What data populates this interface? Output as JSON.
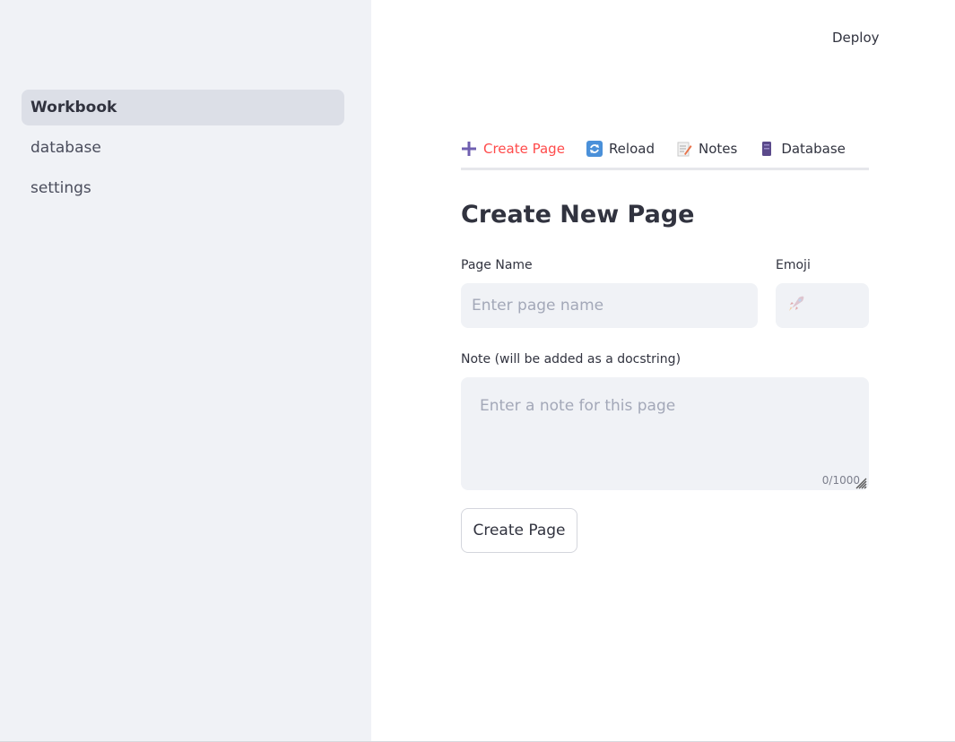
{
  "sidebar": {
    "items": [
      {
        "label": "Workbook"
      },
      {
        "label": "database"
      },
      {
        "label": "settings"
      }
    ]
  },
  "header": {
    "deploy_label": "Deploy"
  },
  "tabs": [
    {
      "label": "Create Page",
      "icon": "plus-icon"
    },
    {
      "label": "Reload",
      "icon": "reload-icon"
    },
    {
      "label": "Notes",
      "icon": "memo-icon"
    },
    {
      "label": "Database",
      "icon": "database-icon"
    },
    {
      "label": "",
      "icon": "gear-icon"
    }
  ],
  "form": {
    "title": "Create New Page",
    "page_name": {
      "label": "Page Name",
      "placeholder": "Enter page name"
    },
    "emoji": {
      "label": "Emoji",
      "value": "rocket-icon"
    },
    "note": {
      "label": "Note (will be added as a docstring)",
      "placeholder": "Enter a note for this page",
      "counter": "0/1000"
    },
    "submit_label": "Create Page"
  },
  "colors": {
    "accent": "#ff4b4b",
    "sidebar_bg": "#f0f2f6",
    "input_bg": "#f0f2f6"
  }
}
